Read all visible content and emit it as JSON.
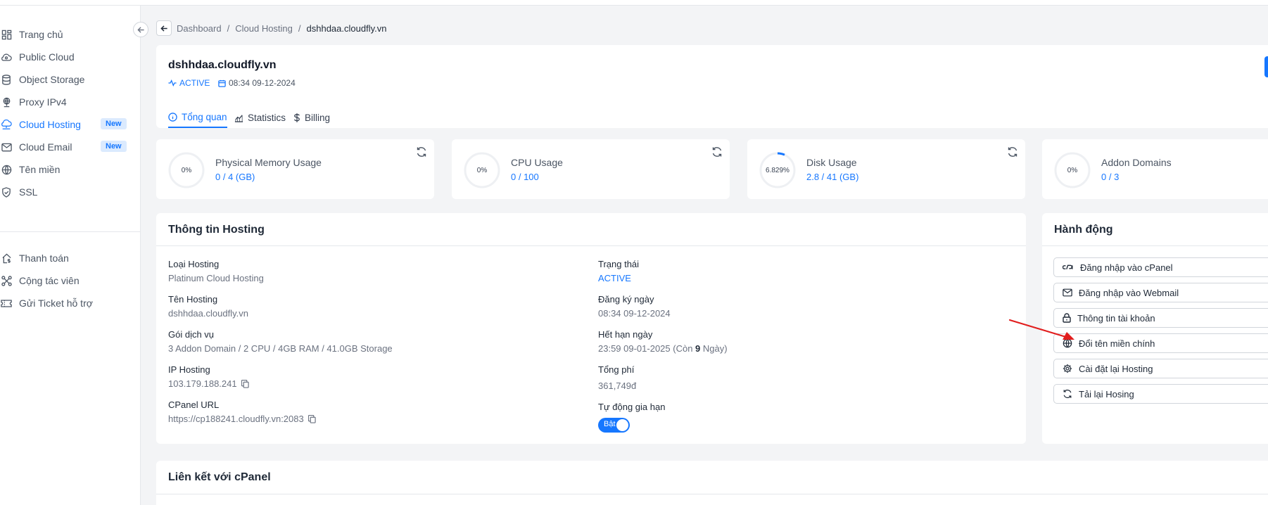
{
  "sidebar": {
    "items": [
      {
        "label": "Trang chủ",
        "icon": "dashboard-icon"
      },
      {
        "label": "Public Cloud",
        "icon": "cloud-gear-icon"
      },
      {
        "label": "Object Storage",
        "icon": "database-icon"
      },
      {
        "label": "Proxy IPv4",
        "icon": "globe-network-icon"
      },
      {
        "label": "Cloud Hosting",
        "icon": "cloud-network-icon",
        "badge": "New",
        "active": true
      },
      {
        "label": "Cloud Email",
        "icon": "mail-icon",
        "badge": "New"
      },
      {
        "label": "Tên miền",
        "icon": "globe-icon"
      },
      {
        "label": "SSL",
        "icon": "shield-check-icon"
      },
      {
        "label": "Thanh toán",
        "icon": "home-dollar-icon"
      },
      {
        "label": "Cộng tác viên",
        "icon": "network-icon"
      },
      {
        "label": "Gửi Ticket hỗ trợ",
        "icon": "ticket-icon"
      }
    ]
  },
  "breadcrumb": {
    "items": [
      "Dashboard",
      "Cloud Hosting",
      "dshhdaa.cloudfly.vn"
    ]
  },
  "header": {
    "title": "dshhdaa.cloudfly.vn",
    "status": "ACTIVE",
    "created": "08:34 09-12-2024"
  },
  "tabs": [
    {
      "label": "Tổng quan",
      "icon": "info-icon",
      "active": true
    },
    {
      "label": "Statistics",
      "icon": "chart-icon"
    },
    {
      "label": "Billing",
      "icon": "dollar-icon"
    }
  ],
  "stats": [
    {
      "title": "Physical Memory Usage",
      "value": "0 / 4 (GB)",
      "percent_label": "0%",
      "percent": 0
    },
    {
      "title": "CPU Usage",
      "value": "0 / 100",
      "percent_label": "0%",
      "percent": 0
    },
    {
      "title": "Disk Usage",
      "value": "2.8 / 41 (GB)",
      "percent_label": "6.829%",
      "percent": 6.829
    },
    {
      "title": "Addon Domains",
      "value": "0 / 3",
      "percent_label": "0%",
      "percent": 0
    }
  ],
  "hosting_info": {
    "title": "Thông tin Hosting",
    "left": [
      {
        "label": "Loại Hosting",
        "value": "Platinum Cloud Hosting"
      },
      {
        "label": "Tên Hosting",
        "value": "dshhdaa.cloudfly.vn"
      },
      {
        "label": "Gói dịch vụ",
        "value": "3 Addon Domain / 2 CPU / 4GB RAM / 41.0GB Storage"
      },
      {
        "label": "IP Hosting",
        "value": "103.179.188.241"
      },
      {
        "label": "CPanel URL",
        "value": "https://cp188241.cloudfly.vn:2083"
      }
    ],
    "right": [
      {
        "label": "Trạng thái",
        "value": "ACTIVE"
      },
      {
        "label": "Đăng ký ngày",
        "value": "08:34 09-12-2024"
      },
      {
        "label": "Hết hạn ngày",
        "value_prefix": "23:59 09-01-2025 (Còn ",
        "value_bold": "9",
        "value_suffix": " Ngày)"
      },
      {
        "label": "Tổng phí",
        "value": "361,749đ"
      },
      {
        "label": "Tự động gia hạn",
        "toggle_label": "Bật",
        "enabled": true
      }
    ]
  },
  "actions": {
    "title": "Hành động",
    "buttons": [
      {
        "label": "Đăng nhập vào cPanel",
        "icon": "cpanel-icon"
      },
      {
        "label": "Đăng nhập vào Webmail",
        "icon": "mail-icon"
      },
      {
        "label": "Thông tin tài khoản",
        "icon": "lock-icon"
      },
      {
        "label": "Đổi tên miền chính",
        "icon": "globe-icon"
      },
      {
        "label": "Cài đặt lại Hosting",
        "icon": "gear-icon"
      },
      {
        "label": "Tải lại Hosing",
        "icon": "refresh-icon"
      }
    ]
  },
  "cpanel_links": {
    "title": "Liên kết với cPanel"
  },
  "colors": {
    "accent": "#1677ff",
    "annotation_arrow": "#e11d1d"
  }
}
